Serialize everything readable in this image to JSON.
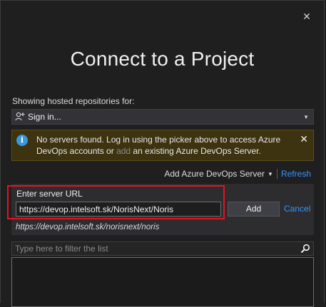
{
  "dialog": {
    "title": "Connect to a Project",
    "close_icon": "close-icon"
  },
  "hosted": {
    "label": "Showing hosted repositories for:",
    "account_selector": "Sign in...",
    "account_icon": "add-user-icon"
  },
  "info_bar": {
    "icon": "info-icon",
    "message_part1": "No servers found. Log in using the picker above to access Azure DevOps accounts or ",
    "add_link": "add",
    "message_part2": " an existing Azure DevOps Server.",
    "dismiss_icon": "close-icon"
  },
  "server_actions": {
    "add_server": "Add Azure DevOps Server",
    "refresh": "Refresh"
  },
  "server_entry": {
    "label": "Enter server URL",
    "value": "https://devop.intelsoft.sk/NorisNext/Noris",
    "add_button": "Add",
    "cancel": "Cancel",
    "url_preview": "https://devop.intelsoft.sk/norisnext/noris"
  },
  "filter": {
    "placeholder": "Type here to filter the list",
    "icon": "search-icon"
  },
  "colors": {
    "background": "#1f1f1f",
    "info_bar": "#3d3310",
    "link": "#3794ff",
    "highlight_border": "#e81123"
  }
}
